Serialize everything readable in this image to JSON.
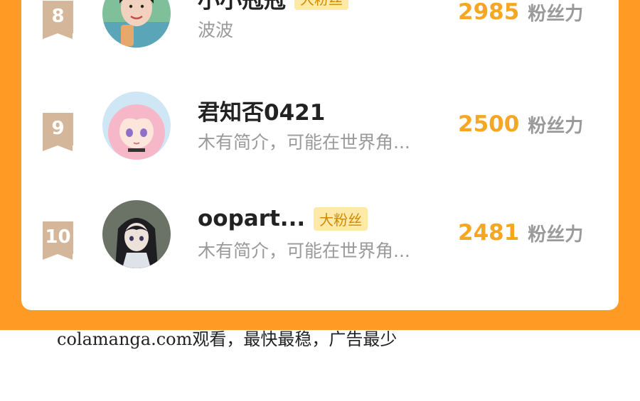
{
  "colors": {
    "accent_orange": "#FF9A24",
    "score_color": "#F5A623",
    "rank_badge": "#D4B79A",
    "fan_badge_bg": "#FFE9A8"
  },
  "list": {
    "score_unit": "粉丝力",
    "rows": [
      {
        "rank": "8",
        "name": "小小冠冠",
        "badge": "大粉丝",
        "desc": "波波",
        "score": "2985",
        "avatar": "photo-avatar"
      },
      {
        "rank": "9",
        "name": "君知否0421",
        "badge": "",
        "desc": "木有简介，可能在世界角...",
        "score": "2500",
        "avatar": "anime-pink-hair-avatar"
      },
      {
        "rank": "10",
        "name": "oopart...",
        "badge": "大粉丝",
        "desc": "木有简介，可能在世界角...",
        "score": "2481",
        "avatar": "anime-dark-hair-avatar"
      }
    ]
  },
  "footer": {
    "text": "colamanga.com观看，最快最稳，广告最少"
  }
}
